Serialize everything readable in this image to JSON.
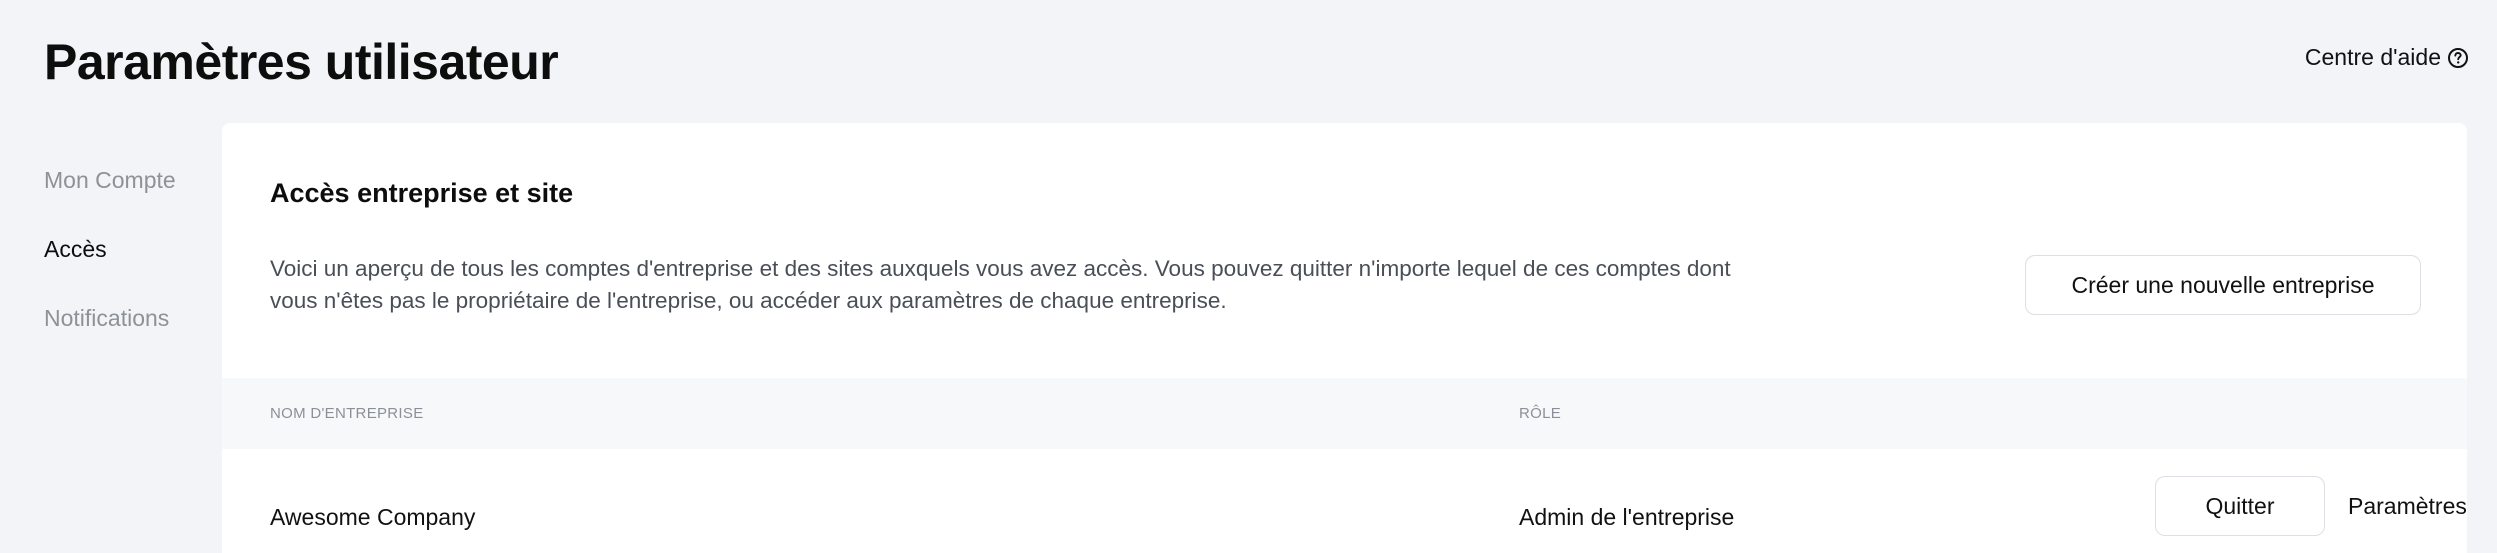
{
  "header": {
    "title": "Paramètres utilisateur",
    "help_label": "Centre d'aide",
    "help_icon": "question-circle-icon"
  },
  "sidebar": {
    "items": [
      {
        "label": "Mon Compte",
        "active": false
      },
      {
        "label": "Accès",
        "active": true
      },
      {
        "label": "Notifications",
        "active": false
      }
    ]
  },
  "access": {
    "title": "Accès entreprise et site",
    "description": "Voici un aperçu de tous les comptes d'entreprise et des sites auxquels vous avez accès. Vous pouvez quitter n'importe lequel de ces comptes dont vous n'êtes pas le propriétaire de l'entreprise, ou accéder aux paramètres de chaque entreprise.",
    "create_button": "Créer une nouvelle entreprise",
    "table": {
      "columns": [
        "NOM D'ENTREPRISE",
        "RÔLE"
      ],
      "rows": [
        {
          "name": "Awesome Company",
          "role": "Admin de l'entreprise",
          "quit_label": "Quitter",
          "settings_label": "Paramètres"
        }
      ]
    }
  },
  "colors": {
    "background": "#f3f4f7",
    "card": "#ffffff",
    "muted_text": "#8d9299",
    "table_header_bg": "#f7f8fa"
  }
}
